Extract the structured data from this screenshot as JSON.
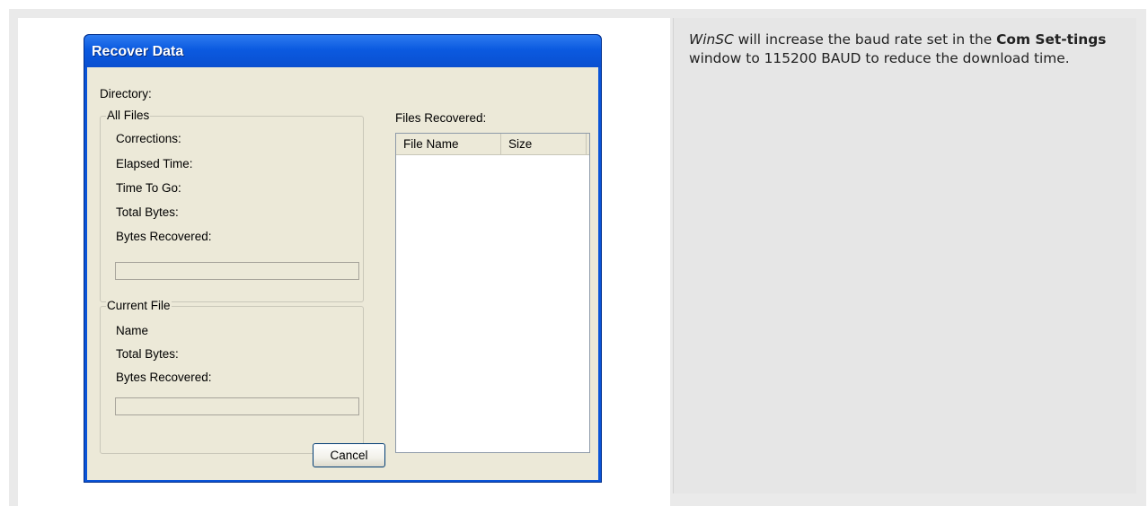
{
  "dialog": {
    "title": "Recover Data",
    "directory_label": "Directory:",
    "all_files": {
      "caption": "All Files",
      "corrections": "Corrections:",
      "elapsed_time": "Elapsed Time:",
      "time_to_go": "Time To Go:",
      "total_bytes": "Total Bytes:",
      "bytes_recovered": "Bytes Recovered:",
      "progress": 0
    },
    "current_file": {
      "caption": "Current File",
      "name": "Name",
      "total_bytes": "Total Bytes:",
      "bytes_recovered": "Bytes Recovered:",
      "progress": 0
    },
    "files_recovered": {
      "label": "Files Recovered:",
      "columns": [
        "File Name",
        "Size"
      ],
      "rows": []
    },
    "cancel_label": "Cancel"
  },
  "note": {
    "app_name": "WinSC",
    "text_1": " will increase the baud rate set in the ",
    "window_name": "Com Set-tings",
    "text_2": " window to 115200 BAUD to reduce the download time."
  },
  "colors": {
    "titlebar": "#0a54d8",
    "dialog_face": "#ece9d8",
    "note_background": "#e6e6e6"
  }
}
